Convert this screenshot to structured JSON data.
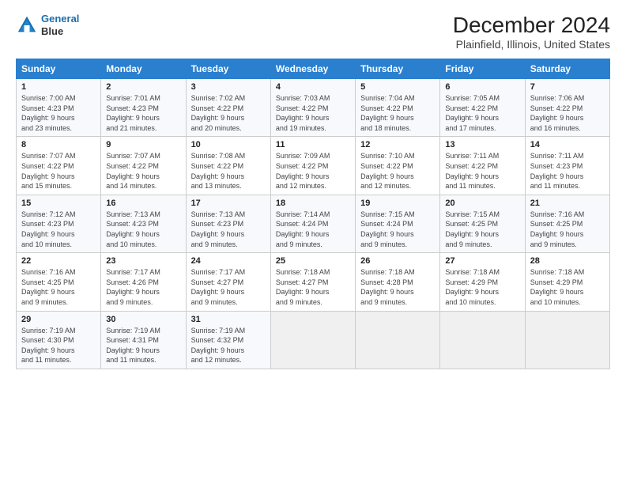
{
  "logo": {
    "line1": "General",
    "line2": "Blue"
  },
  "title": "December 2024",
  "subtitle": "Plainfield, Illinois, United States",
  "days_header": [
    "Sunday",
    "Monday",
    "Tuesday",
    "Wednesday",
    "Thursday",
    "Friday",
    "Saturday"
  ],
  "weeks": [
    [
      {
        "day": "1",
        "info": "Sunrise: 7:00 AM\nSunset: 4:23 PM\nDaylight: 9 hours\nand 23 minutes."
      },
      {
        "day": "2",
        "info": "Sunrise: 7:01 AM\nSunset: 4:23 PM\nDaylight: 9 hours\nand 21 minutes."
      },
      {
        "day": "3",
        "info": "Sunrise: 7:02 AM\nSunset: 4:22 PM\nDaylight: 9 hours\nand 20 minutes."
      },
      {
        "day": "4",
        "info": "Sunrise: 7:03 AM\nSunset: 4:22 PM\nDaylight: 9 hours\nand 19 minutes."
      },
      {
        "day": "5",
        "info": "Sunrise: 7:04 AM\nSunset: 4:22 PM\nDaylight: 9 hours\nand 18 minutes."
      },
      {
        "day": "6",
        "info": "Sunrise: 7:05 AM\nSunset: 4:22 PM\nDaylight: 9 hours\nand 17 minutes."
      },
      {
        "day": "7",
        "info": "Sunrise: 7:06 AM\nSunset: 4:22 PM\nDaylight: 9 hours\nand 16 minutes."
      }
    ],
    [
      {
        "day": "8",
        "info": "Sunrise: 7:07 AM\nSunset: 4:22 PM\nDaylight: 9 hours\nand 15 minutes."
      },
      {
        "day": "9",
        "info": "Sunrise: 7:07 AM\nSunset: 4:22 PM\nDaylight: 9 hours\nand 14 minutes."
      },
      {
        "day": "10",
        "info": "Sunrise: 7:08 AM\nSunset: 4:22 PM\nDaylight: 9 hours\nand 13 minutes."
      },
      {
        "day": "11",
        "info": "Sunrise: 7:09 AM\nSunset: 4:22 PM\nDaylight: 9 hours\nand 12 minutes."
      },
      {
        "day": "12",
        "info": "Sunrise: 7:10 AM\nSunset: 4:22 PM\nDaylight: 9 hours\nand 12 minutes."
      },
      {
        "day": "13",
        "info": "Sunrise: 7:11 AM\nSunset: 4:22 PM\nDaylight: 9 hours\nand 11 minutes."
      },
      {
        "day": "14",
        "info": "Sunrise: 7:11 AM\nSunset: 4:23 PM\nDaylight: 9 hours\nand 11 minutes."
      }
    ],
    [
      {
        "day": "15",
        "info": "Sunrise: 7:12 AM\nSunset: 4:23 PM\nDaylight: 9 hours\nand 10 minutes."
      },
      {
        "day": "16",
        "info": "Sunrise: 7:13 AM\nSunset: 4:23 PM\nDaylight: 9 hours\nand 10 minutes."
      },
      {
        "day": "17",
        "info": "Sunrise: 7:13 AM\nSunset: 4:23 PM\nDaylight: 9 hours\nand 9 minutes."
      },
      {
        "day": "18",
        "info": "Sunrise: 7:14 AM\nSunset: 4:24 PM\nDaylight: 9 hours\nand 9 minutes."
      },
      {
        "day": "19",
        "info": "Sunrise: 7:15 AM\nSunset: 4:24 PM\nDaylight: 9 hours\nand 9 minutes."
      },
      {
        "day": "20",
        "info": "Sunrise: 7:15 AM\nSunset: 4:25 PM\nDaylight: 9 hours\nand 9 minutes."
      },
      {
        "day": "21",
        "info": "Sunrise: 7:16 AM\nSunset: 4:25 PM\nDaylight: 9 hours\nand 9 minutes."
      }
    ],
    [
      {
        "day": "22",
        "info": "Sunrise: 7:16 AM\nSunset: 4:25 PM\nDaylight: 9 hours\nand 9 minutes."
      },
      {
        "day": "23",
        "info": "Sunrise: 7:17 AM\nSunset: 4:26 PM\nDaylight: 9 hours\nand 9 minutes."
      },
      {
        "day": "24",
        "info": "Sunrise: 7:17 AM\nSunset: 4:27 PM\nDaylight: 9 hours\nand 9 minutes."
      },
      {
        "day": "25",
        "info": "Sunrise: 7:18 AM\nSunset: 4:27 PM\nDaylight: 9 hours\nand 9 minutes."
      },
      {
        "day": "26",
        "info": "Sunrise: 7:18 AM\nSunset: 4:28 PM\nDaylight: 9 hours\nand 9 minutes."
      },
      {
        "day": "27",
        "info": "Sunrise: 7:18 AM\nSunset: 4:29 PM\nDaylight: 9 hours\nand 10 minutes."
      },
      {
        "day": "28",
        "info": "Sunrise: 7:18 AM\nSunset: 4:29 PM\nDaylight: 9 hours\nand 10 minutes."
      }
    ],
    [
      {
        "day": "29",
        "info": "Sunrise: 7:19 AM\nSunset: 4:30 PM\nDaylight: 9 hours\nand 11 minutes."
      },
      {
        "day": "30",
        "info": "Sunrise: 7:19 AM\nSunset: 4:31 PM\nDaylight: 9 hours\nand 11 minutes."
      },
      {
        "day": "31",
        "info": "Sunrise: 7:19 AM\nSunset: 4:32 PM\nDaylight: 9 hours\nand 12 minutes."
      },
      null,
      null,
      null,
      null
    ]
  ]
}
